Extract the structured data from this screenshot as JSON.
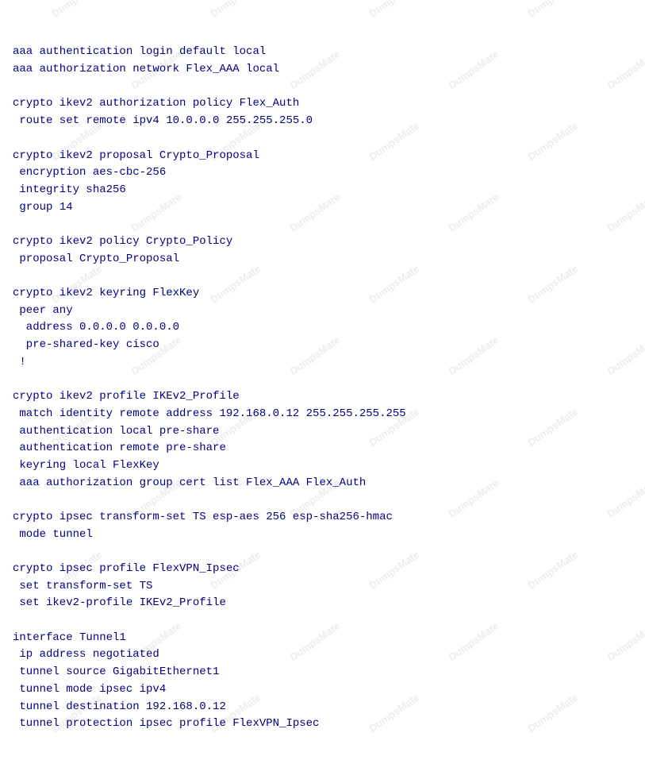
{
  "page": {
    "background": "#ffffff",
    "watermark": "DumpsMate"
  },
  "code": {
    "lines": [
      "aaa authentication login default local",
      "aaa authorization network Flex_AAA local",
      "",
      "crypto ikev2 authorization policy Flex_Auth",
      " route set remote ipv4 10.0.0.0 255.255.255.0",
      "",
      "crypto ikev2 proposal Crypto_Proposal",
      " encryption aes-cbc-256",
      " integrity sha256",
      " group 14",
      "",
      "crypto ikev2 policy Crypto_Policy",
      " proposal Crypto_Proposal",
      "",
      "crypto ikev2 keyring FlexKey",
      " peer any",
      "  address 0.0.0.0 0.0.0.0",
      "  pre-shared-key cisco",
      " !",
      "",
      "crypto ikev2 profile IKEv2_Profile",
      " match identity remote address 192.168.0.12 255.255.255.255",
      " authentication local pre-share",
      " authentication remote pre-share",
      " keyring local FlexKey",
      " aaa authorization group cert list Flex_AAA Flex_Auth",
      "",
      "crypto ipsec transform-set TS esp-aes 256 esp-sha256-hmac",
      " mode tunnel",
      "",
      "crypto ipsec profile FlexVPN_Ipsec",
      " set transform-set TS",
      " set ikev2-profile IKEv2_Profile",
      "",
      "interface Tunnel1",
      " ip address negotiated",
      " tunnel source GigabitEthernet1",
      " tunnel mode ipsec ipv4",
      " tunnel destination 192.168.0.12",
      " tunnel protection ipsec profile FlexVPN_Ipsec"
    ]
  }
}
